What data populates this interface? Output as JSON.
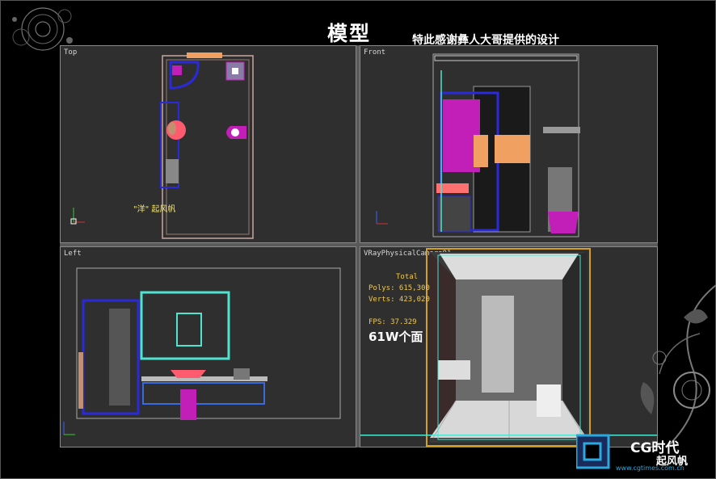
{
  "header": {
    "title": "模型",
    "subtitle": "特此感谢彝人大哥提供的设计"
  },
  "viewports": {
    "top": {
      "label": "Top",
      "watermark": "\"洋\" 起风帆"
    },
    "front": {
      "label": "Front"
    },
    "left": {
      "label": "Left"
    },
    "camera": {
      "label": "VRayPhysicalCamera01",
      "stats_title": "Total",
      "polys": "Polys: 615,300",
      "verts": "Verts: 423,020",
      "fps": "FPS:  37.329",
      "note": "61W个面"
    }
  },
  "logo": {
    "brand": "CG时代",
    "url": "www.cgtimes.com.cn",
    "author": "起风帆"
  },
  "colors": {
    "background": "#000000",
    "viewport_bg": "#2f2f2f",
    "wire_blue": "#2a2ad8",
    "wire_cyan": "#4fe3d0",
    "wire_magenta": "#c21fb8",
    "stat_yellow": "#f2c94c"
  }
}
